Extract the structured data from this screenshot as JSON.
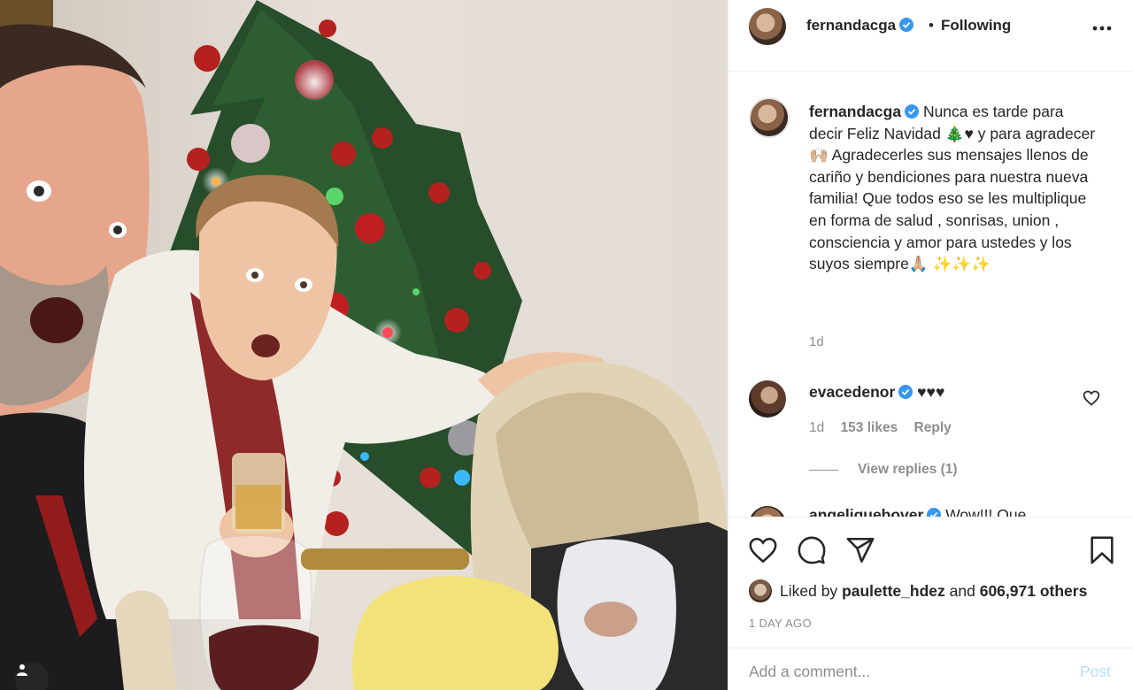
{
  "post": {
    "username": "fernandacga",
    "follow_status": "Following",
    "dot": "•"
  },
  "caption": {
    "username": "fernandacga",
    "text": "Nunca es tarde para decir Feliz Navidad 🎄♥ y para agradecer 🙌🏼 Agradecerles sus mensajes llenos de cariño y bendiciones para nuestra nueva familia! Que todos eso se les multiplique en forma de salud , sonrisas, union , consciencia y amor para ustedes y los suyos siempre🙏🏼 ✨✨✨",
    "time": "1d"
  },
  "comments": [
    {
      "username": "evacedenor",
      "text": "♥♥♥",
      "time": "1d",
      "likes": "153 likes",
      "reply_label": "Reply",
      "view_replies": "View replies (1)"
    },
    {
      "username": "angeliquebover",
      "text": "Wow!!! Que"
    }
  ],
  "likes": {
    "prefix": "Liked by",
    "user": "paulette_hdez",
    "middle": "and",
    "count": "606,971 others"
  },
  "timestamp": "1 DAY AGO",
  "comment_box": {
    "placeholder": "Add a comment...",
    "post_label": "Post"
  },
  "colors": {
    "verified": "#3897f0",
    "text": "#262626",
    "muted": "#8e8e8e",
    "post_disabled": "#b2dffc",
    "border": "#efefef"
  },
  "icons": {
    "more": "more-icon",
    "verified": "verified-badge-icon",
    "like": "heart-icon",
    "comment": "comment-icon",
    "share": "share-icon",
    "save": "bookmark-icon",
    "photo_user": "user-tag-icon"
  }
}
